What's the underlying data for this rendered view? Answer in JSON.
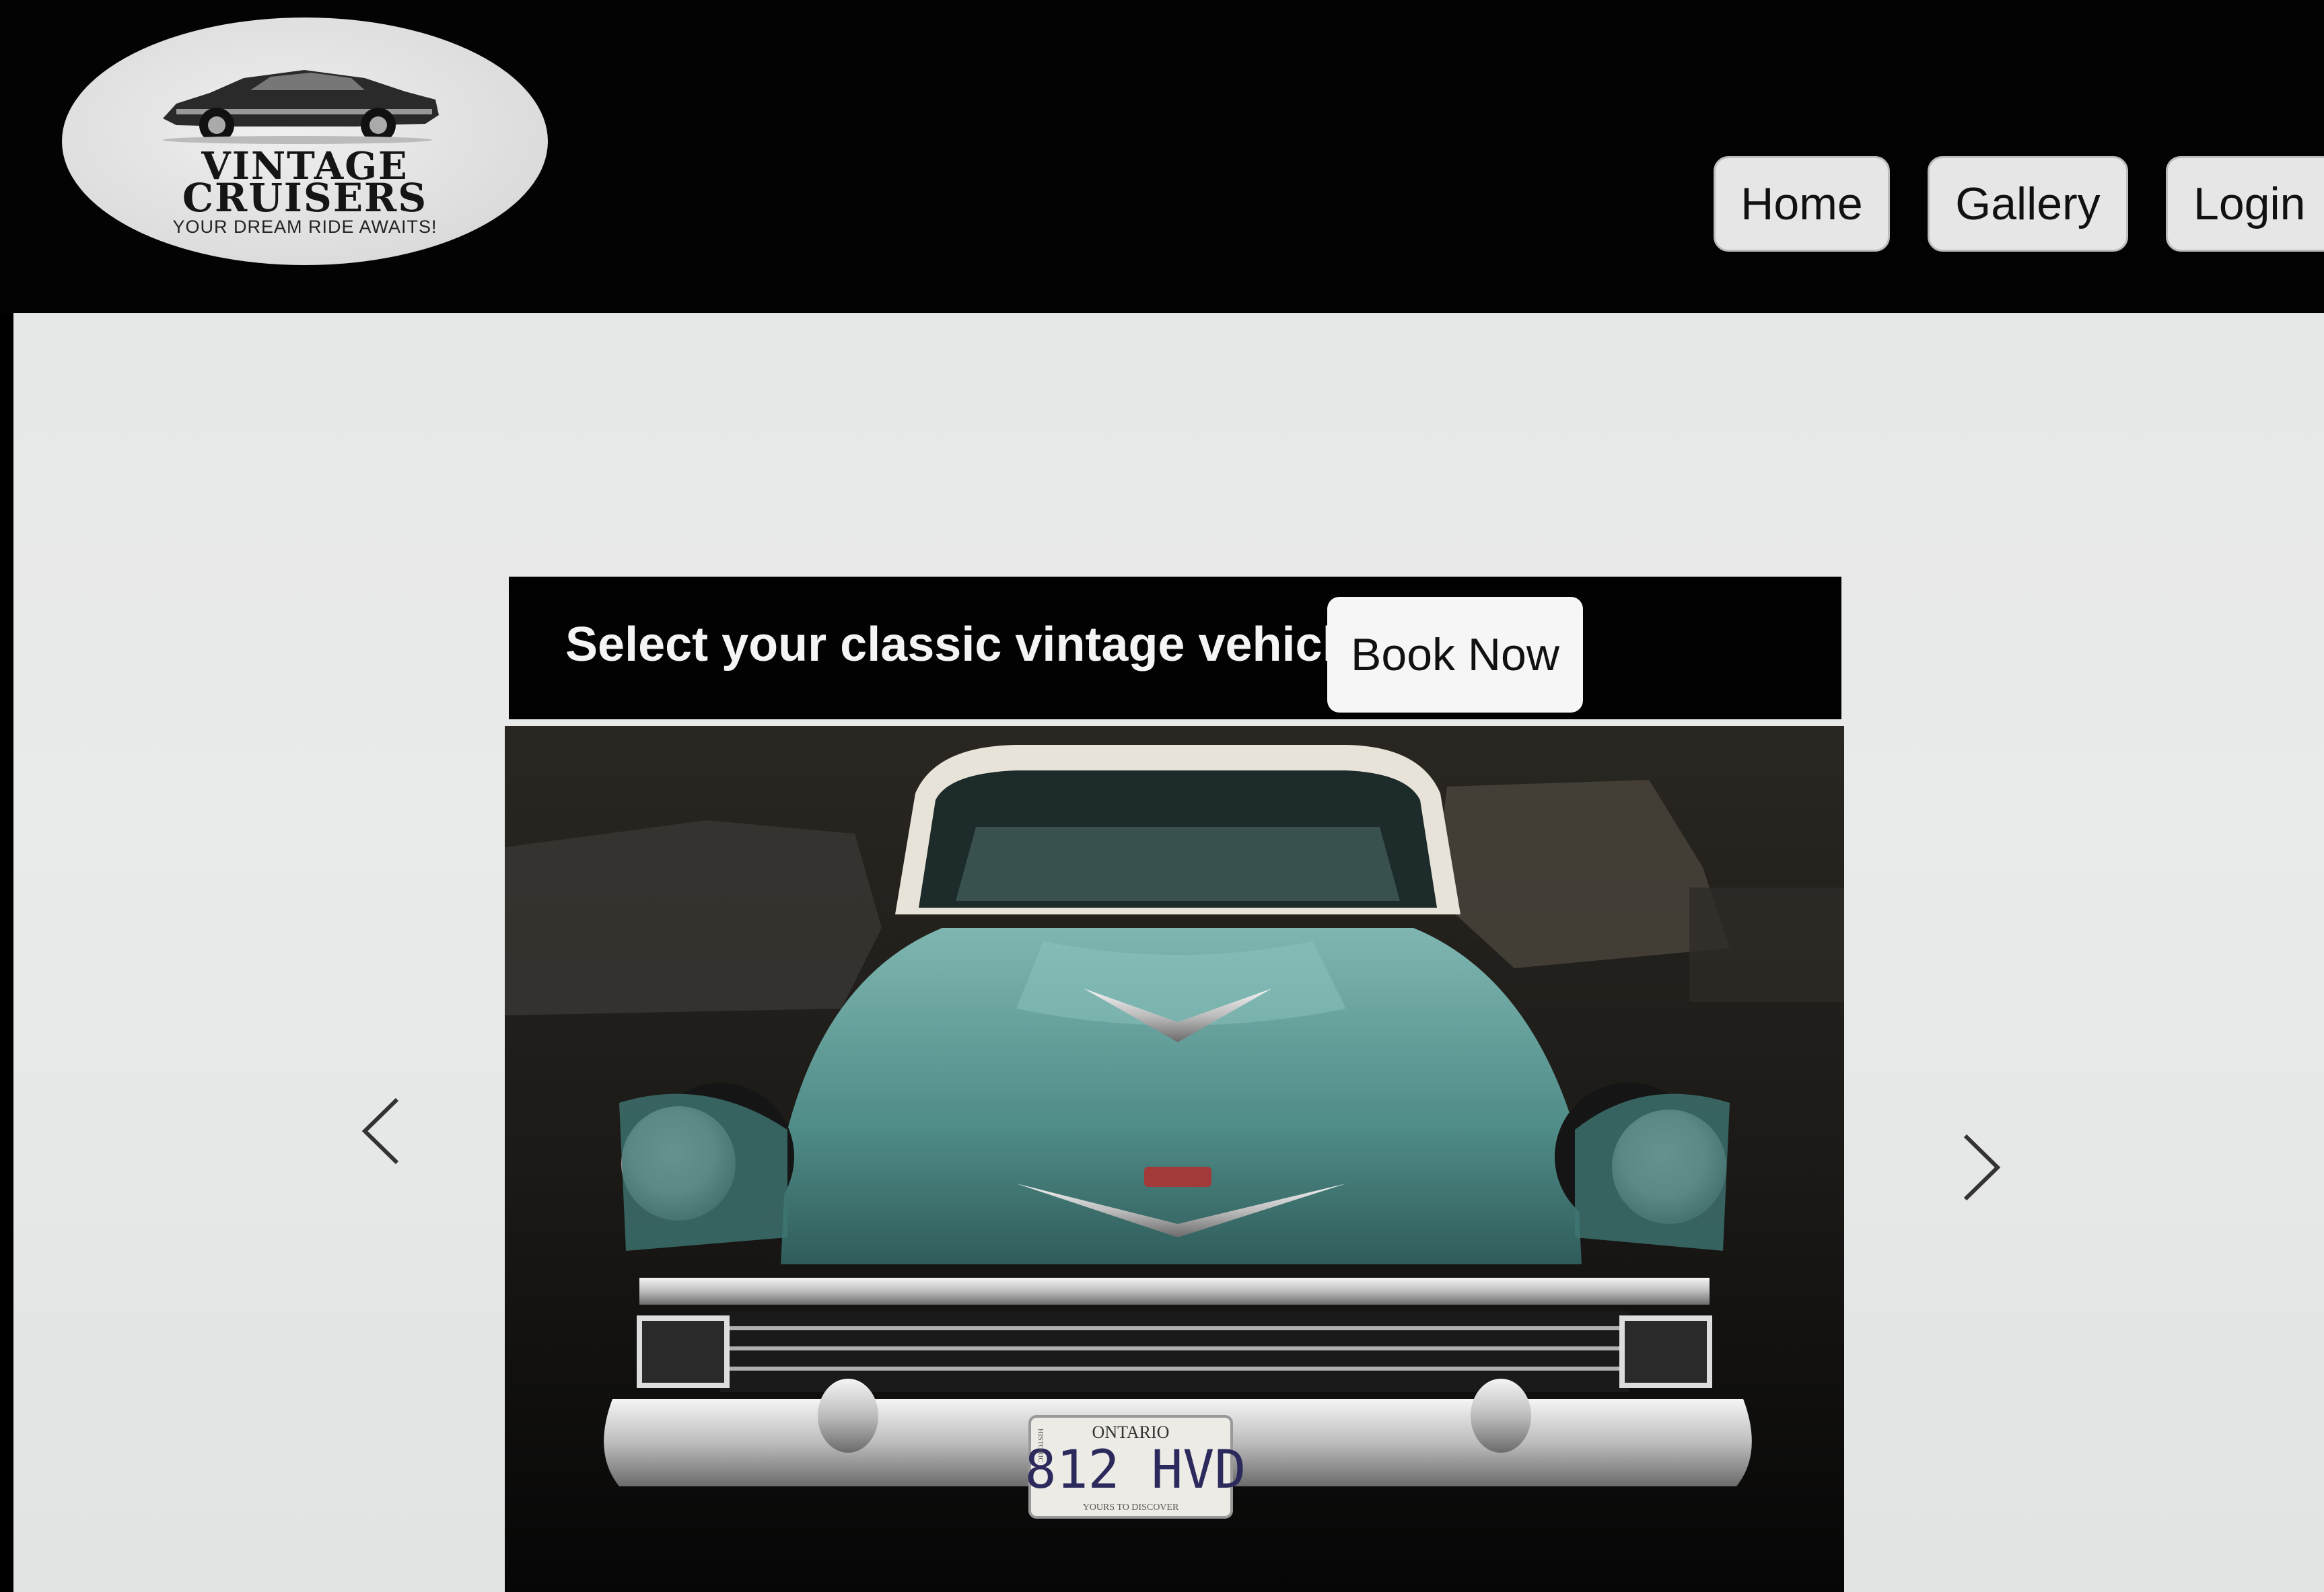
{
  "header": {
    "logo": {
      "line1": "VINTAGE",
      "line2": "CRUISERS",
      "tagline": "YOUR DREAM RIDE AWAITS!"
    },
    "nav": {
      "home": "Home",
      "gallery": "Gallery",
      "login": "Login"
    }
  },
  "main": {
    "booking_title": "Select your classic vintage vehicle",
    "book_button": "Book Now",
    "carousel": {
      "photo": {
        "plate_region": "ONTARIO",
        "plate_number": "812 HVD",
        "plate_side": "HISTORIC",
        "plate_slogan": "YOURS TO DISCOVER"
      },
      "prev_icon": "chevron-left-icon",
      "next_icon": "chevron-right-icon"
    }
  },
  "colors": {
    "header_bg": "#030303",
    "content_bg": "#e6e7e7",
    "button_bg": "#e6e6e6",
    "car_teal": "#5f9c98"
  }
}
